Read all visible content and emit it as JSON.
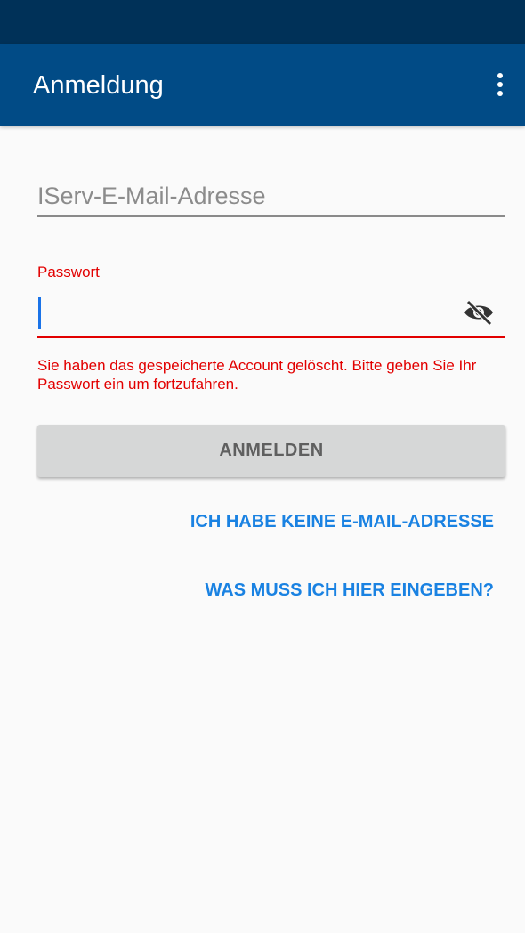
{
  "app_bar": {
    "title": "Anmeldung",
    "menu_icon": "more-vert-icon",
    "color": "#014b86",
    "status_bar_color": "#003158"
  },
  "form": {
    "email": {
      "placeholder": "IServ-E-Mail-Adresse",
      "value": ""
    },
    "password": {
      "label": "Passwort",
      "value": "",
      "visibility_icon": "eye-off-icon",
      "error": "Sie haben das gespeicherte Account gelöscht. Bitte geben Sie Ihr Passwort ein um fortzufahren.",
      "error_color": "#e20000"
    },
    "login_button": "ANMELDEN"
  },
  "links": {
    "no_email": "ICH HABE KEINE E-MAIL-ADRESSE",
    "help": "WAS MUSS ICH HIER EINGEBEN?",
    "color": "#1a82e2"
  }
}
